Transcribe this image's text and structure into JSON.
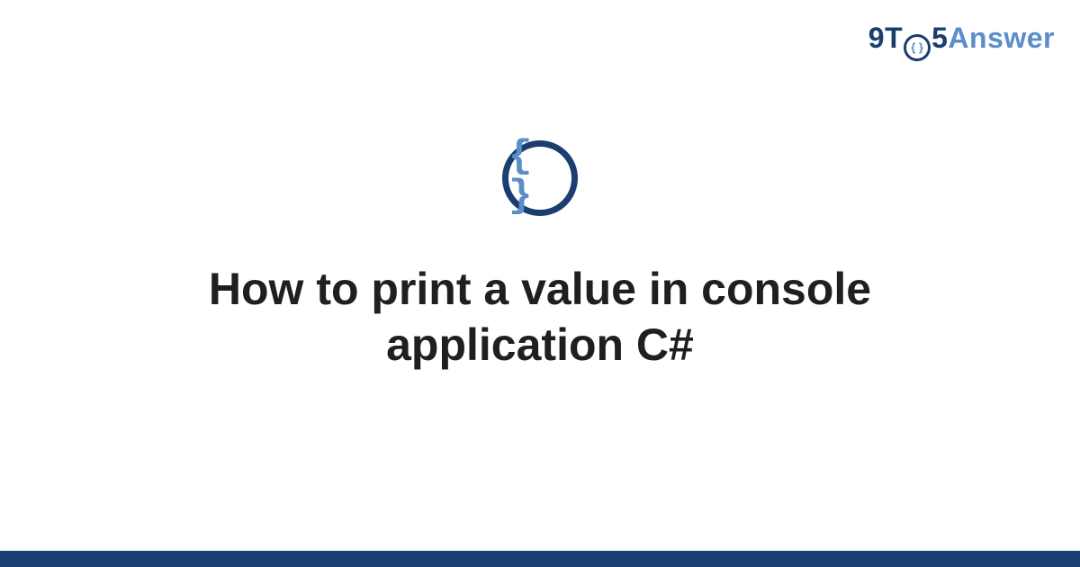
{
  "logo": {
    "part1": "9T",
    "circle_inner": "{ }",
    "part3": "5",
    "part4": "Answer"
  },
  "icon": {
    "braces": "{ }"
  },
  "title": "How to print a value in console application C#",
  "colors": {
    "brand_dark": "#1a3e6f",
    "brand_light": "#5b8dc9"
  }
}
